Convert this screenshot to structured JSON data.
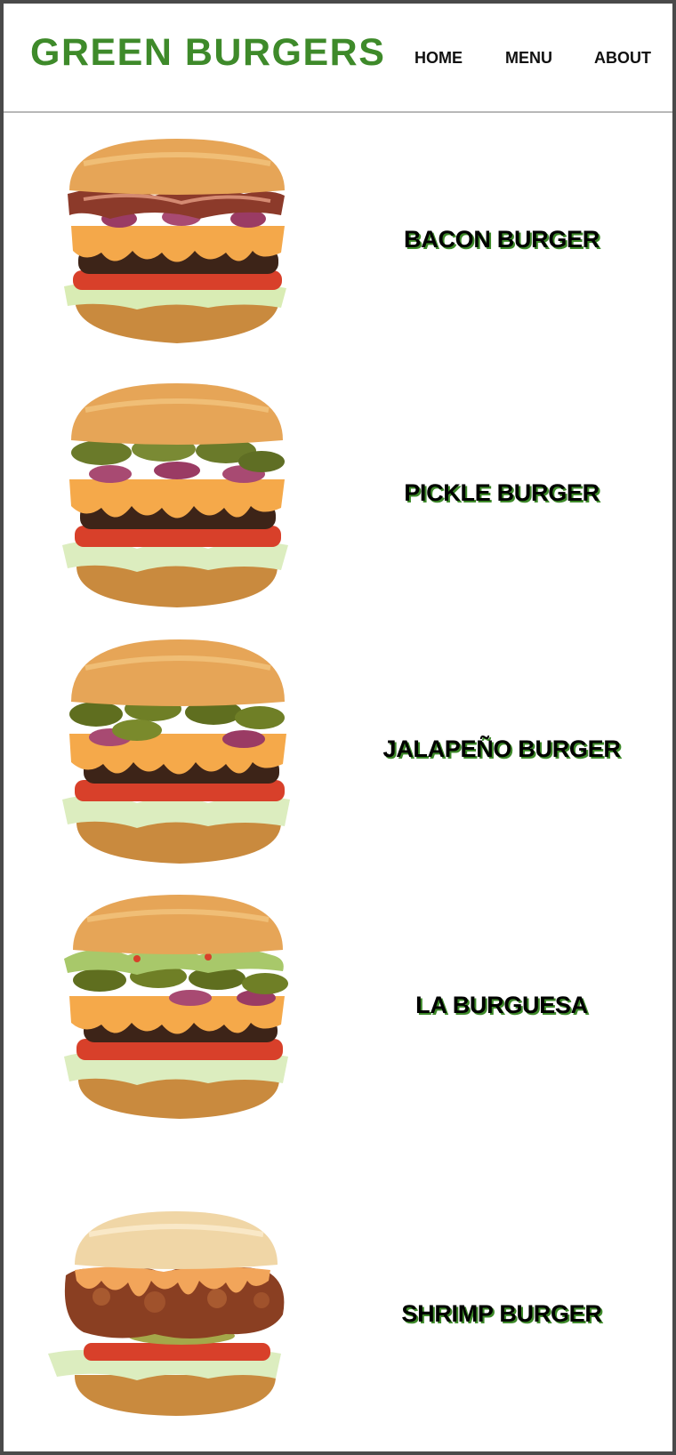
{
  "header": {
    "brand": "GREEN BURGERS",
    "nav": {
      "home": "HOME",
      "menu": "MENU",
      "about": "ABOUT"
    }
  },
  "menu_items": [
    {
      "name": "BACON BURGER",
      "image": "bacon-burger-image"
    },
    {
      "name": "PICKLE BURGER",
      "image": "pickle-burger-image"
    },
    {
      "name": "JALAPEÑO BURGER",
      "image": "jalapeno-burger-image"
    },
    {
      "name": "LA BURGUESA",
      "image": "la-burguesa-image"
    },
    {
      "name": "SHRIMP BURGER",
      "image": "shrimp-burger-image"
    }
  ],
  "colors": {
    "brand_green": "#3e8a2a",
    "text": "#000000",
    "divider": "#b8b8b8"
  }
}
